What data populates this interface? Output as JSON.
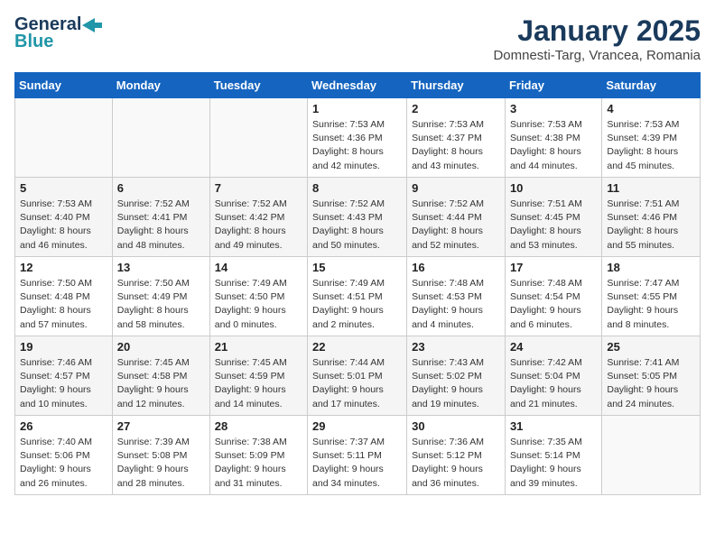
{
  "header": {
    "logo_general": "General",
    "logo_blue": "Blue",
    "title": "January 2025",
    "location": "Domnesti-Targ, Vrancea, Romania"
  },
  "weekdays": [
    "Sunday",
    "Monday",
    "Tuesday",
    "Wednesday",
    "Thursday",
    "Friday",
    "Saturday"
  ],
  "weeks": [
    [
      {
        "day": "",
        "info": ""
      },
      {
        "day": "",
        "info": ""
      },
      {
        "day": "",
        "info": ""
      },
      {
        "day": "1",
        "info": "Sunrise: 7:53 AM\nSunset: 4:36 PM\nDaylight: 8 hours\nand 42 minutes."
      },
      {
        "day": "2",
        "info": "Sunrise: 7:53 AM\nSunset: 4:37 PM\nDaylight: 8 hours\nand 43 minutes."
      },
      {
        "day": "3",
        "info": "Sunrise: 7:53 AM\nSunset: 4:38 PM\nDaylight: 8 hours\nand 44 minutes."
      },
      {
        "day": "4",
        "info": "Sunrise: 7:53 AM\nSunset: 4:39 PM\nDaylight: 8 hours\nand 45 minutes."
      }
    ],
    [
      {
        "day": "5",
        "info": "Sunrise: 7:53 AM\nSunset: 4:40 PM\nDaylight: 8 hours\nand 46 minutes."
      },
      {
        "day": "6",
        "info": "Sunrise: 7:52 AM\nSunset: 4:41 PM\nDaylight: 8 hours\nand 48 minutes."
      },
      {
        "day": "7",
        "info": "Sunrise: 7:52 AM\nSunset: 4:42 PM\nDaylight: 8 hours\nand 49 minutes."
      },
      {
        "day": "8",
        "info": "Sunrise: 7:52 AM\nSunset: 4:43 PM\nDaylight: 8 hours\nand 50 minutes."
      },
      {
        "day": "9",
        "info": "Sunrise: 7:52 AM\nSunset: 4:44 PM\nDaylight: 8 hours\nand 52 minutes."
      },
      {
        "day": "10",
        "info": "Sunrise: 7:51 AM\nSunset: 4:45 PM\nDaylight: 8 hours\nand 53 minutes."
      },
      {
        "day": "11",
        "info": "Sunrise: 7:51 AM\nSunset: 4:46 PM\nDaylight: 8 hours\nand 55 minutes."
      }
    ],
    [
      {
        "day": "12",
        "info": "Sunrise: 7:50 AM\nSunset: 4:48 PM\nDaylight: 8 hours\nand 57 minutes."
      },
      {
        "day": "13",
        "info": "Sunrise: 7:50 AM\nSunset: 4:49 PM\nDaylight: 8 hours\nand 58 minutes."
      },
      {
        "day": "14",
        "info": "Sunrise: 7:49 AM\nSunset: 4:50 PM\nDaylight: 9 hours\nand 0 minutes."
      },
      {
        "day": "15",
        "info": "Sunrise: 7:49 AM\nSunset: 4:51 PM\nDaylight: 9 hours\nand 2 minutes."
      },
      {
        "day": "16",
        "info": "Sunrise: 7:48 AM\nSunset: 4:53 PM\nDaylight: 9 hours\nand 4 minutes."
      },
      {
        "day": "17",
        "info": "Sunrise: 7:48 AM\nSunset: 4:54 PM\nDaylight: 9 hours\nand 6 minutes."
      },
      {
        "day": "18",
        "info": "Sunrise: 7:47 AM\nSunset: 4:55 PM\nDaylight: 9 hours\nand 8 minutes."
      }
    ],
    [
      {
        "day": "19",
        "info": "Sunrise: 7:46 AM\nSunset: 4:57 PM\nDaylight: 9 hours\nand 10 minutes."
      },
      {
        "day": "20",
        "info": "Sunrise: 7:45 AM\nSunset: 4:58 PM\nDaylight: 9 hours\nand 12 minutes."
      },
      {
        "day": "21",
        "info": "Sunrise: 7:45 AM\nSunset: 4:59 PM\nDaylight: 9 hours\nand 14 minutes."
      },
      {
        "day": "22",
        "info": "Sunrise: 7:44 AM\nSunset: 5:01 PM\nDaylight: 9 hours\nand 17 minutes."
      },
      {
        "day": "23",
        "info": "Sunrise: 7:43 AM\nSunset: 5:02 PM\nDaylight: 9 hours\nand 19 minutes."
      },
      {
        "day": "24",
        "info": "Sunrise: 7:42 AM\nSunset: 5:04 PM\nDaylight: 9 hours\nand 21 minutes."
      },
      {
        "day": "25",
        "info": "Sunrise: 7:41 AM\nSunset: 5:05 PM\nDaylight: 9 hours\nand 24 minutes."
      }
    ],
    [
      {
        "day": "26",
        "info": "Sunrise: 7:40 AM\nSunset: 5:06 PM\nDaylight: 9 hours\nand 26 minutes."
      },
      {
        "day": "27",
        "info": "Sunrise: 7:39 AM\nSunset: 5:08 PM\nDaylight: 9 hours\nand 28 minutes."
      },
      {
        "day": "28",
        "info": "Sunrise: 7:38 AM\nSunset: 5:09 PM\nDaylight: 9 hours\nand 31 minutes."
      },
      {
        "day": "29",
        "info": "Sunrise: 7:37 AM\nSunset: 5:11 PM\nDaylight: 9 hours\nand 34 minutes."
      },
      {
        "day": "30",
        "info": "Sunrise: 7:36 AM\nSunset: 5:12 PM\nDaylight: 9 hours\nand 36 minutes."
      },
      {
        "day": "31",
        "info": "Sunrise: 7:35 AM\nSunset: 5:14 PM\nDaylight: 9 hours\nand 39 minutes."
      },
      {
        "day": "",
        "info": ""
      }
    ]
  ]
}
